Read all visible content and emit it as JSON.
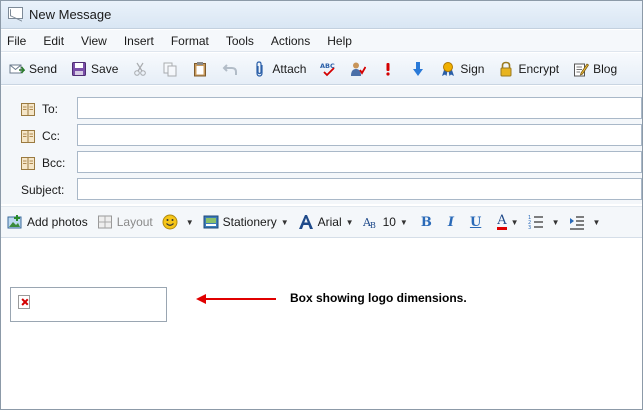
{
  "window": {
    "title": "New Message"
  },
  "menu": [
    "File",
    "Edit",
    "View",
    "Insert",
    "Format",
    "Tools",
    "Actions",
    "Help"
  ],
  "toolbar": {
    "send": "Send",
    "save": "Save",
    "attach": "Attach",
    "sign": "Sign",
    "encrypt": "Encrypt",
    "blog": "Blog"
  },
  "fields": {
    "to_label": "To:",
    "cc_label": "Cc:",
    "bcc_label": "Bcc:",
    "subject_label": "Subject:",
    "to_value": "",
    "cc_value": "",
    "bcc_value": "",
    "subject_value": ""
  },
  "formatbar": {
    "add_photos": "Add photos",
    "layout": "Layout",
    "stationery": "Stationery",
    "font_name": "Arial",
    "font_size": "10",
    "bold": "B",
    "italic": "I",
    "underline": "U",
    "font_color": "A"
  },
  "body": {
    "annotation": "Box showing logo dimensions."
  },
  "colors": {
    "annotation_arrow": "#e00000",
    "toolbar_bg": "#e6eef7"
  }
}
